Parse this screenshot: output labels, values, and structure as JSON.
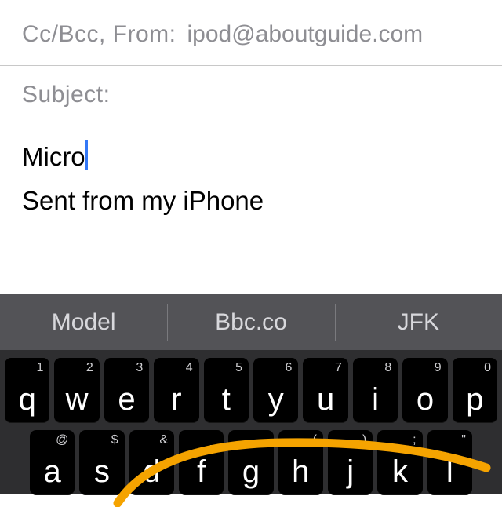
{
  "fields": {
    "ccbcc_label": "Cc/Bcc, From:",
    "from_value": "ipod@aboutguide.com",
    "subject_label": "Subject:"
  },
  "body": {
    "text": "Micro",
    "signature": "Sent from my iPhone"
  },
  "suggestions": {
    "a": "Model",
    "b": "Bbc.co",
    "c": "JFK"
  },
  "keyboard": {
    "row1": [
      {
        "k": "q",
        "h": "1"
      },
      {
        "k": "w",
        "h": "2"
      },
      {
        "k": "e",
        "h": "3"
      },
      {
        "k": "r",
        "h": "4"
      },
      {
        "k": "t",
        "h": "5"
      },
      {
        "k": "y",
        "h": "6"
      },
      {
        "k": "u",
        "h": "7"
      },
      {
        "k": "i",
        "h": "8"
      },
      {
        "k": "o",
        "h": "9"
      },
      {
        "k": "p",
        "h": "0"
      }
    ],
    "row2": [
      {
        "k": "a",
        "h": "@"
      },
      {
        "k": "s",
        "h": "$"
      },
      {
        "k": "d",
        "h": "&"
      },
      {
        "k": "f",
        "h": "_"
      },
      {
        "k": "g",
        "h": "-"
      },
      {
        "k": "h",
        "h": "("
      },
      {
        "k": "j",
        "h": ")"
      },
      {
        "k": "k",
        "h": ";"
      },
      {
        "k": "l",
        "h": "\""
      }
    ]
  }
}
